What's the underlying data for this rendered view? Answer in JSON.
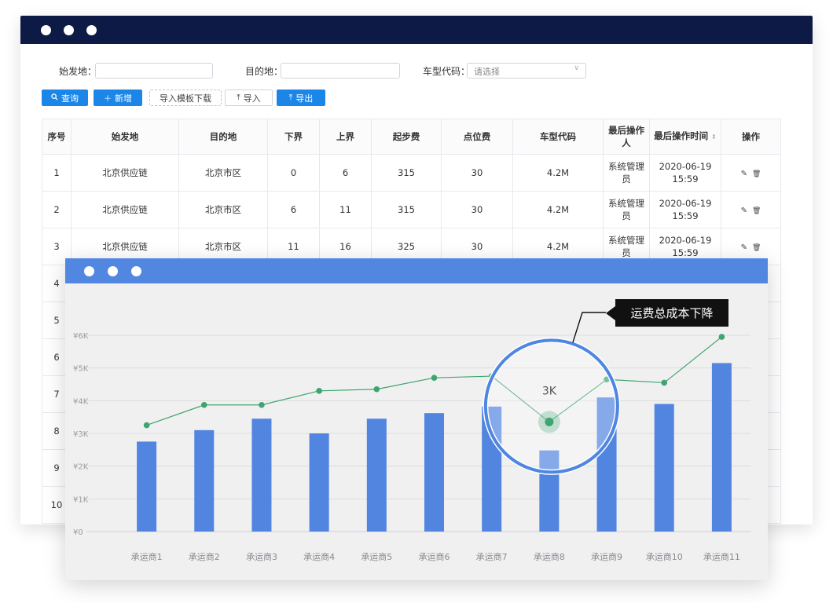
{
  "colors": {
    "topbar": "#0c1a45",
    "primary_button": "#1c86e8",
    "chart_titlebar": "#5187e1",
    "bar": "#5185e0",
    "line": "#3fa46f",
    "tooltip_bg": "#111111"
  },
  "filters": {
    "origin_label": "始发地：",
    "origin_value": "",
    "dest_label": "目的地：",
    "dest_value": "",
    "car_label": "车型代码：",
    "car_placeholder": "请选择"
  },
  "toolbar": {
    "query_label": "查询",
    "query_icon": "search-icon",
    "add_label": "新增",
    "add_icon": "plus-icon",
    "template_label": "导入模板下载",
    "import_label": "导入",
    "import_icon": "upload-icon",
    "export_label": "导出",
    "export_icon": "upload-icon"
  },
  "table": {
    "headers": [
      "序号",
      "始发地",
      "目的地",
      "下界",
      "上界",
      "起步费",
      "点位费",
      "车型代码",
      "最后操作人",
      "最后操作时间",
      "操作"
    ],
    "rows": [
      [
        "1",
        "北京供应链",
        "北京市区",
        "0",
        "6",
        "315",
        "30",
        "4.2M",
        "系统管理员",
        "2020-06-19 15:59"
      ],
      [
        "2",
        "北京供应链",
        "北京市区",
        "6",
        "11",
        "315",
        "30",
        "4.2M",
        "系统管理员",
        "2020-06-19 15:59"
      ],
      [
        "3",
        "北京供应链",
        "北京市区",
        "11",
        "16",
        "325",
        "30",
        "4.2M",
        "系统管理员",
        "2020-06-19 15:59"
      ],
      [
        "4"
      ],
      [
        "5"
      ],
      [
        "6"
      ],
      [
        "7"
      ],
      [
        "8"
      ],
      [
        "9"
      ],
      [
        "10"
      ]
    ],
    "row_action_icons": [
      "edit-icon",
      "delete-icon"
    ]
  },
  "chart_data": {
    "type": "bar",
    "categories": [
      "承运商1",
      "承运商2",
      "承运商3",
      "承运商4",
      "承运商5",
      "承运商6",
      "承运商7",
      "承运商8",
      "承运商9",
      "承运商10",
      "承运商11"
    ],
    "ytick_labels": [
      "¥0",
      "¥1K",
      "¥2K",
      "¥3K",
      "¥4K",
      "¥5K",
      "¥6K"
    ],
    "ylim": [
      0,
      6000
    ],
    "series": [
      {
        "type": "bar",
        "values": [
          2750,
          3100,
          3450,
          3000,
          3450,
          3620,
          3820,
          2480,
          4100,
          3900,
          5150
        ]
      },
      {
        "type": "line",
        "values": [
          3250,
          3870,
          3870,
          4300,
          4350,
          4700,
          4750,
          3350,
          4650,
          4550,
          5950
        ]
      }
    ],
    "grid": true,
    "highlight": {
      "index": 7,
      "label": "3K"
    },
    "annotation": "运费总成本下降"
  }
}
